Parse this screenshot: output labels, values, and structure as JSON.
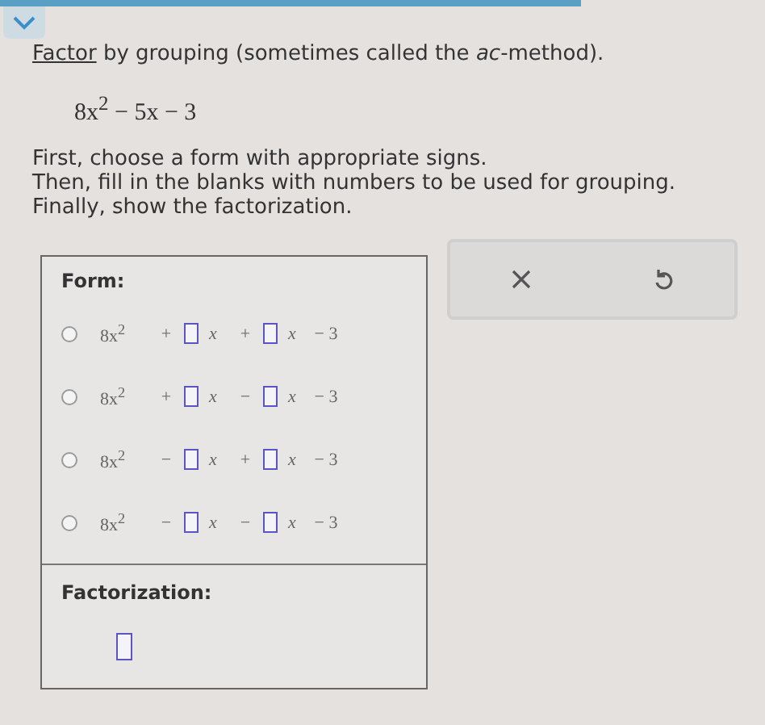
{
  "prompt": {
    "link": "Factor",
    "text": "by grouping (sometimes called the *ac*-method)."
  },
  "expression": "8x$^{2}$ − 5x − 3",
  "instructions": [
    "First, choose a form with appropriate signs.",
    "Then, fill in the blanks with numbers to be used for grouping.",
    "Finally, show the factorization."
  ],
  "form": {
    "heading": "Form:",
    "options": [
      {
        "selected": false,
        "lead": "8x$^{2}$",
        "sign_1": "+",
        "var_1": "*x*",
        "sign_2": "+",
        "var_2": "*x*",
        "constant": "− 3"
      },
      {
        "selected": false,
        "lead": "8x$^{2}$",
        "sign_1": "+",
        "var_1": "*x*",
        "sign_2": "−",
        "var_2": "*x*",
        "constant": "− 3"
      },
      {
        "selected": false,
        "lead": "8x$^{2}$",
        "sign_1": "−",
        "var_1": "*x*",
        "sign_2": "+",
        "var_2": "*x*",
        "constant": "− 3"
      },
      {
        "selected": false,
        "lead": "8x$^{2}$",
        "sign_1": "−",
        "var_1": "*x*",
        "sign_2": "−",
        "var_2": "*x*",
        "constant": "− 3"
      }
    ]
  },
  "factorization": {
    "heading": "Factorization:"
  }
}
